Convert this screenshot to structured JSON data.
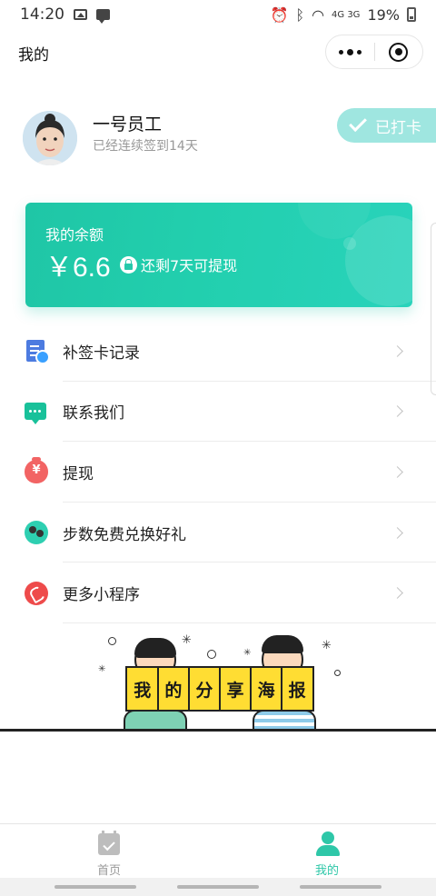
{
  "status_bar": {
    "time": "14:20",
    "network": "4G 3G",
    "battery": "19%"
  },
  "nav": {
    "title": "我的"
  },
  "profile": {
    "name": "一号员工",
    "subtitle": "已经连续签到14天",
    "checkin_label": "已打卡"
  },
  "balance": {
    "label": "我的余额",
    "amount": "￥6.6",
    "note": "还剩7天可提现"
  },
  "menu": {
    "items": [
      {
        "label": "补签卡记录",
        "icon": "document-check-icon"
      },
      {
        "label": "联系我们",
        "icon": "chat-bubble-icon"
      },
      {
        "label": "提现",
        "icon": "money-bag-icon"
      },
      {
        "label": "步数免费兑换好礼",
        "icon": "footsteps-icon"
      },
      {
        "label": "更多小程序",
        "icon": "mini-program-icon"
      }
    ]
  },
  "poster": {
    "banner_chars": [
      "我",
      "的",
      "分",
      "享",
      "海",
      "报"
    ]
  },
  "tabbar": {
    "tabs": [
      {
        "label": "首页",
        "icon": "calendar-check-icon"
      },
      {
        "label": "我的",
        "icon": "user-icon"
      }
    ]
  },
  "colors": {
    "accent": "#2ec7a8",
    "card_gradient_start": "#1fc6a6",
    "checkin_bg": "#9fe6e0"
  }
}
